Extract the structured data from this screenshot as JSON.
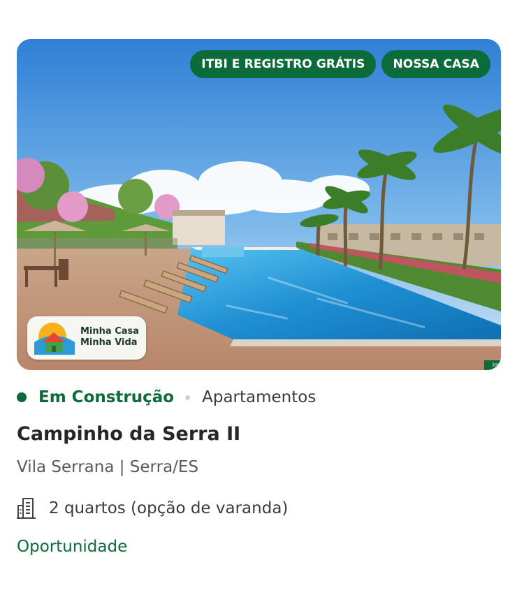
{
  "card": {
    "tags": [
      "ITBI E REGISTRO GRÁTIS",
      "NOSSA CASA"
    ],
    "badge": {
      "line1": "Minha Casa",
      "line2": "Minha Vida",
      "icon": "house-sun-logo"
    },
    "corner_mark": "Im",
    "status": "Em Construção",
    "property_type": "Apartamentos",
    "title": "Campinho da Serra II",
    "location": "Vila Serrana | Serra/ES",
    "rooms": {
      "icon": "building-icon",
      "text": "2 quartos (opção de varanda)"
    },
    "link_label": "Oportunidade"
  },
  "colors": {
    "brand_green": "#0c6b3a",
    "text_dark": "#262626",
    "text_muted": "#5a5a5a",
    "separator": "#cfcfcf"
  }
}
